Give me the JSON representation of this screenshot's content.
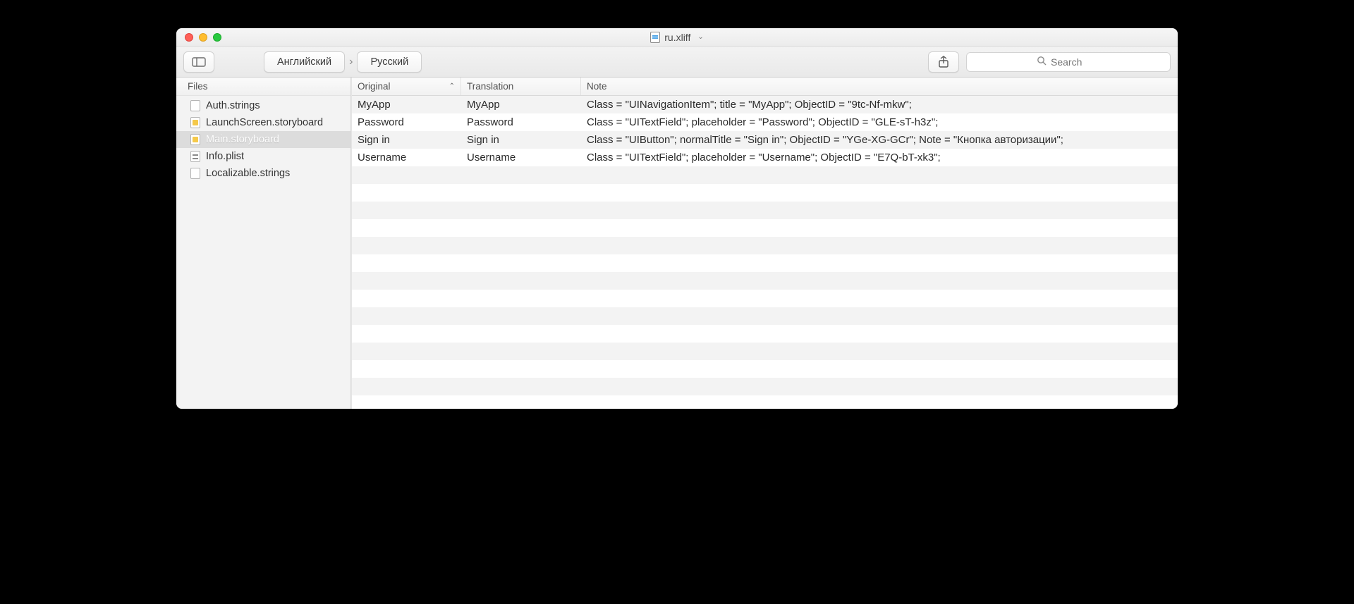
{
  "titlebar": {
    "title": "ru.xliff"
  },
  "toolbar": {
    "source_lang": "Английский",
    "target_lang": "Русский",
    "search_placeholder": "Search"
  },
  "sidebar": {
    "header": "Files",
    "items": [
      {
        "name": "Auth.strings",
        "icon": "plain",
        "selected": false
      },
      {
        "name": "LaunchScreen.storyboard",
        "icon": "yellow",
        "selected": false
      },
      {
        "name": "Main.storyboard",
        "icon": "yellow",
        "selected": true
      },
      {
        "name": "Info.plist",
        "icon": "plist",
        "selected": false
      },
      {
        "name": "Localizable.strings",
        "icon": "plain",
        "selected": false
      }
    ]
  },
  "table": {
    "columns": {
      "original": "Original",
      "translation": "Translation",
      "note": "Note"
    },
    "rows": [
      {
        "original": "MyApp",
        "translation": "MyApp",
        "note": "Class = \"UINavigationItem\"; title = \"MyApp\"; ObjectID = \"9tc-Nf-mkw\";"
      },
      {
        "original": "Password",
        "translation": "Password",
        "note": "Class = \"UITextField\"; placeholder = \"Password\"; ObjectID = \"GLE-sT-h3z\";"
      },
      {
        "original": "Sign in",
        "translation": "Sign in",
        "note": "Class = \"UIButton\"; normalTitle = \"Sign in\"; ObjectID = \"YGe-XG-GCr\"; Note = \"Кнопка авторизации\";"
      },
      {
        "original": "Username",
        "translation": "Username",
        "note": "Class = \"UITextField\"; placeholder = \"Username\"; ObjectID = \"E7Q-bT-xk3\";"
      }
    ]
  }
}
